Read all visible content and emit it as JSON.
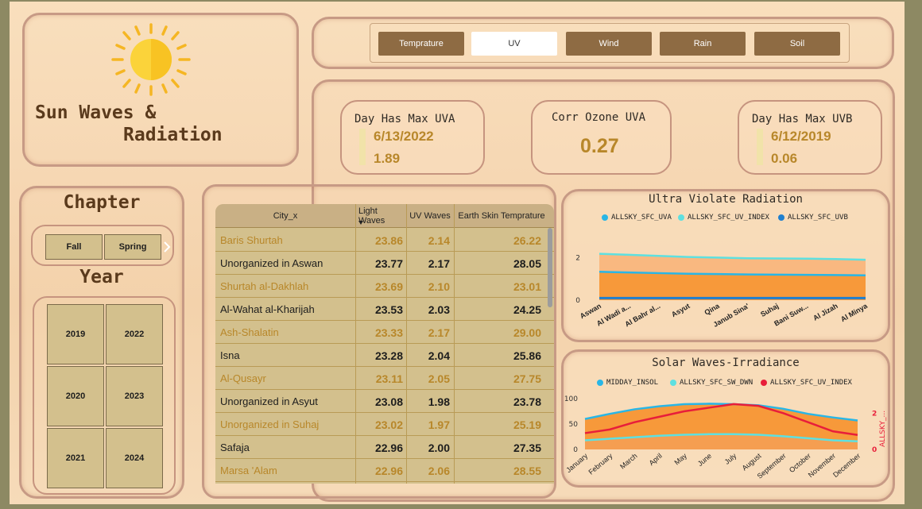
{
  "title": {
    "line1": "Sun Waves &",
    "line2": "Radiation"
  },
  "tabs": [
    {
      "label": "Temprature",
      "active": false
    },
    {
      "label": "UV",
      "active": true
    },
    {
      "label": "Wind",
      "active": false
    },
    {
      "label": "Rain",
      "active": false
    },
    {
      "label": "Soil",
      "active": false
    }
  ],
  "kpis": {
    "max_uva": {
      "title": "Day Has Max UVA",
      "date": "6/13/2022",
      "value": "1.89"
    },
    "corr": {
      "title": "Corr Ozone UVA",
      "value": "0.27"
    },
    "max_uvb": {
      "title": "Day Has Max UVB",
      "date": "6/12/2019",
      "value": "0.06"
    }
  },
  "chapter": {
    "title": "Chapter",
    "options": [
      "Fall",
      "Spring"
    ]
  },
  "year": {
    "title": "Year",
    "options": [
      "2019",
      "2022",
      "2020",
      "2023",
      "2021",
      "2024"
    ]
  },
  "table": {
    "columns": [
      "City_x",
      "Light Waves",
      "UV Waves",
      "Earth Skin Temprature"
    ],
    "sort_column": "Light Waves",
    "rows": [
      [
        "Baris Shurtah",
        "23.86",
        "2.14",
        "26.22"
      ],
      [
        "Unorganized in Aswan",
        "23.77",
        "2.17",
        "28.05"
      ],
      [
        "Shurtah al-Dakhlah",
        "23.69",
        "2.10",
        "23.01"
      ],
      [
        "Al-Wahat al-Kharijah",
        "23.53",
        "2.03",
        "24.25"
      ],
      [
        "Ash-Shalatin",
        "23.33",
        "2.17",
        "29.00"
      ],
      [
        "Isna",
        "23.28",
        "2.04",
        "25.86"
      ],
      [
        "Al-Qusayr",
        "23.11",
        "2.05",
        "27.75"
      ],
      [
        "Unorganized in Asyut",
        "23.08",
        "1.98",
        "23.78"
      ],
      [
        "Unorganized in Suhaj",
        "23.02",
        "1.97",
        "25.19"
      ],
      [
        "Safaja",
        "22.96",
        "2.00",
        "27.35"
      ],
      [
        "Marsa 'Alam",
        "22.96",
        "2.06",
        "28.55"
      ]
    ]
  },
  "chart_data": [
    {
      "type": "area",
      "title": "Ultra Violate Radiation",
      "categories": [
        "Aswan",
        "Al Wadi a...",
        "Al Bahr al...",
        "Asyut",
        "Qina",
        "Janub Sina'",
        "Suhaj",
        "Bani Suw...",
        "Al Jizah",
        "Al Minya"
      ],
      "series": [
        {
          "name": "ALLSKY_SFC_UVA",
          "color": "#29b6e6",
          "values": [
            2.15,
            2.1,
            2.05,
            2.0,
            1.98,
            1.95,
            1.93,
            1.92,
            1.9,
            1.88
          ]
        },
        {
          "name": "ALLSKY_SFC_UV_INDEX",
          "color": "#5ee0e0",
          "values": [
            2.18,
            2.13,
            2.08,
            2.03,
            2.0,
            1.97,
            1.96,
            1.95,
            1.93,
            1.9
          ]
        },
        {
          "name": "ALLSKY_SFC_UVB",
          "color": "#1e7fcf",
          "values": [
            0.06,
            0.06,
            0.06,
            0.06,
            0.06,
            0.06,
            0.06,
            0.06,
            0.06,
            0.06
          ]
        }
      ],
      "y_ticks": [
        "0",
        "2"
      ],
      "ylim": [
        0,
        2.5
      ],
      "legend": "top"
    },
    {
      "type": "area",
      "title": "Solar Waves-Irradiance",
      "categories": [
        "January",
        "February",
        "March",
        "April",
        "May",
        "June",
        "July",
        "August",
        "September",
        "October",
        "November",
        "December"
      ],
      "series": [
        {
          "name": "MIDDAY_INSOL",
          "color": "#29b6e6",
          "values": [
            60,
            70,
            79,
            85,
            89,
            90,
            89,
            87,
            80,
            70,
            63,
            57
          ]
        },
        {
          "name": "ALLSKY_SFC_SW_DWN",
          "color": "#5ee0e0",
          "values": [
            18,
            21,
            24,
            27,
            29,
            30,
            30,
            29,
            26,
            22,
            18,
            16
          ]
        },
        {
          "name": "ALLSKY_SFC_UV_INDEX",
          "color": "#e81e3a",
          "axis": "right",
          "values": [
            0.9,
            1.1,
            1.5,
            1.8,
            2.1,
            2.3,
            2.5,
            2.4,
            2.0,
            1.5,
            1.0,
            0.8
          ]
        }
      ],
      "y_ticks": [
        "0",
        "50",
        "100"
      ],
      "ylim": [
        0,
        100
      ],
      "y2_ticks": [
        "0",
        "2"
      ],
      "y2_label": "ALLSKY_...",
      "y2lim": [
        0,
        2.8
      ],
      "legend": "top"
    }
  ]
}
